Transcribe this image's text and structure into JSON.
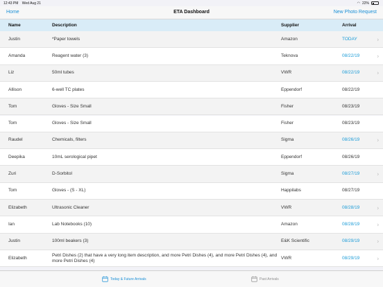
{
  "status_bar": {
    "time": "12:43 PM",
    "date": "Wed Aug 21",
    "battery": "22%"
  },
  "nav": {
    "back_label": "Home",
    "title": "ETA Dashboard",
    "action_label": "New Photo Request"
  },
  "columns": {
    "name": "Name",
    "description": "Description",
    "supplier": "Supplier",
    "arrival": "Arrival"
  },
  "rows": [
    {
      "name": "Justin",
      "description": "*Paper towels",
      "supplier": "Amazon",
      "arrival": "TODAY",
      "highlight": true
    },
    {
      "name": "Amanda",
      "description": "Reagent water (3)",
      "supplier": "Teknova",
      "arrival": "08/22/19",
      "highlight": true
    },
    {
      "name": "Liz",
      "description": "50ml tubes",
      "supplier": "VWR",
      "arrival": "08/22/19",
      "highlight": true
    },
    {
      "name": "Allison",
      "description": "6-well TC plates",
      "supplier": "Eppendorf",
      "arrival": "08/22/19",
      "highlight": false
    },
    {
      "name": "Tom",
      "description": "Gloves - Size Small",
      "supplier": "Fisher",
      "arrival": "08/23/19",
      "highlight": false
    },
    {
      "name": "Tom",
      "description": "Gloves - Size Small",
      "supplier": "Fisher",
      "arrival": "08/23/19",
      "highlight": false
    },
    {
      "name": "Raudel",
      "description": "Chemicals, filters",
      "supplier": "Sigma",
      "arrival": "08/26/19",
      "highlight": true
    },
    {
      "name": "Deepika",
      "description": "10mL serological pipet",
      "supplier": "Eppendorf",
      "arrival": "08/26/19",
      "highlight": false
    },
    {
      "name": "Zuri",
      "description": "D-Sorbitol",
      "supplier": "Sigma",
      "arrival": "08/27/19",
      "highlight": true
    },
    {
      "name": "Tom",
      "description": "Gloves - (S - XL)",
      "supplier": "Happilabs",
      "arrival": "08/27/19",
      "highlight": false
    },
    {
      "name": "Elizabeth",
      "description": "Ultrasonic Cleaner",
      "supplier": "VWR",
      "arrival": "08/28/19",
      "highlight": true
    },
    {
      "name": "Ian",
      "description": "Lab Notebooks (10)",
      "supplier": "Amazon",
      "arrival": "08/28/19",
      "highlight": true
    },
    {
      "name": "Justin",
      "description": "100ml beakers (3)",
      "supplier": "E&K Scientific",
      "arrival": "08/29/19",
      "highlight": true
    },
    {
      "name": "Elizabeth",
      "description": "Petri Dishes (2) that have a very long item description, and more Petri Dishes (4), and more Petri Dishes (4), and more Petri Dishes (4)",
      "supplier": "VWR",
      "arrival": "08/29/19",
      "highlight": true
    }
  ],
  "tabs": {
    "active_label": "Today & Future Arrivals",
    "inactive_label": "Past Arrivals"
  },
  "colors": {
    "accent": "#1a8fd6",
    "header_bg": "#d9ecf7",
    "arrival_blue": "#1a9bd7"
  }
}
